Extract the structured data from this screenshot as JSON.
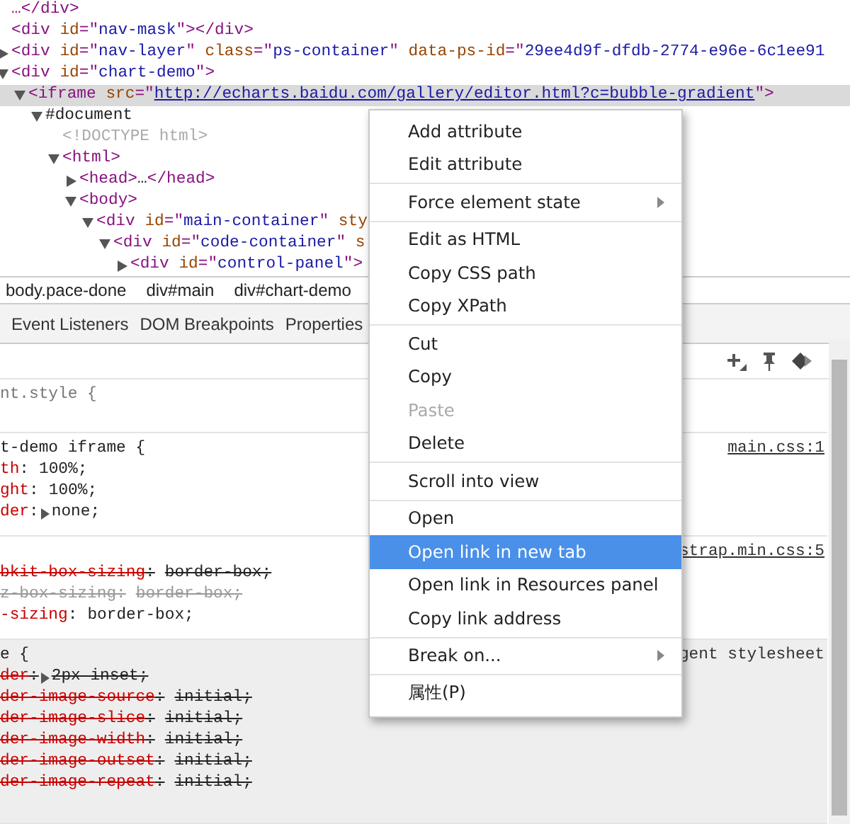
{
  "tree": [
    {
      "selected": false,
      "parts": [
        {
          "kind": "tag",
          "text": "…</div>"
        }
      ]
    },
    {
      "selected": false,
      "parts": [
        {
          "kind": "tag",
          "text": "<div "
        },
        {
          "kind": "attr",
          "text": "id"
        },
        {
          "kind": "tag",
          "text": "=\""
        },
        {
          "kind": "value",
          "text": "nav-mask"
        },
        {
          "kind": "tag",
          "text": "\"></div>"
        }
      ]
    },
    {
      "selected": false,
      "expanded": false,
      "parts": [
        {
          "kind": "tag",
          "text": "<div "
        },
        {
          "kind": "attr",
          "text": "id"
        },
        {
          "kind": "tag",
          "text": "=\""
        },
        {
          "kind": "value",
          "text": "nav-layer"
        },
        {
          "kind": "tag",
          "text": "\" "
        },
        {
          "kind": "attr",
          "text": "class"
        },
        {
          "kind": "tag",
          "text": "=\""
        },
        {
          "kind": "value",
          "text": "ps-container"
        },
        {
          "kind": "tag",
          "text": "\" "
        },
        {
          "kind": "attr",
          "text": "data-ps-id"
        },
        {
          "kind": "tag",
          "text": "=\""
        },
        {
          "kind": "value",
          "text": "29ee4d9f-dfdb-2774-e96e-6c1ee91"
        }
      ]
    },
    {
      "selected": false,
      "expanded": true,
      "parts": [
        {
          "kind": "tag",
          "text": "<div "
        },
        {
          "kind": "attr",
          "text": "id"
        },
        {
          "kind": "tag",
          "text": "=\""
        },
        {
          "kind": "value",
          "text": "chart-demo"
        },
        {
          "kind": "tag",
          "text": "\">"
        }
      ],
      "children": [
        {
          "selected": true,
          "expanded": true,
          "parts": [
            {
              "kind": "tag",
              "text": "<iframe "
            },
            {
              "kind": "attr",
              "text": "src"
            },
            {
              "kind": "tag",
              "text": "=\""
            },
            {
              "kind": "link",
              "text": "http://echarts.baidu.com/gallery/editor.html?c=bubble-gradient"
            },
            {
              "kind": "tag",
              "text": "\">"
            }
          ],
          "children": [
            {
              "selected": false,
              "expanded": true,
              "parts": [
                {
                  "kind": "plain",
                  "text": "#document"
                }
              ],
              "children": [
                {
                  "selected": false,
                  "parts": [
                    {
                      "kind": "comment",
                      "text": "<!DOCTYPE html>"
                    }
                  ]
                },
                {
                  "selected": false,
                  "expanded": true,
                  "parts": [
                    {
                      "kind": "tag",
                      "text": "<html>"
                    }
                  ],
                  "children": [
                    {
                      "selected": false,
                      "expanded": false,
                      "parts": [
                        {
                          "kind": "tag",
                          "text": "<head>"
                        },
                        {
                          "kind": "plain",
                          "text": "…"
                        },
                        {
                          "kind": "tag",
                          "text": "</head>"
                        }
                      ]
                    },
                    {
                      "selected": false,
                      "expanded": true,
                      "parts": [
                        {
                          "kind": "tag",
                          "text": "<body>"
                        }
                      ],
                      "children": [
                        {
                          "selected": false,
                          "expanded": true,
                          "parts": [
                            {
                              "kind": "tag",
                              "text": "<div "
                            },
                            {
                              "kind": "attr",
                              "text": "id"
                            },
                            {
                              "kind": "tag",
                              "text": "=\""
                            },
                            {
                              "kind": "value",
                              "text": "main-container"
                            },
                            {
                              "kind": "tag",
                              "text": "\" "
                            },
                            {
                              "kind": "attr",
                              "text": "sty"
                            }
                          ],
                          "children": [
                            {
                              "selected": false,
                              "expanded": true,
                              "parts": [
                                {
                                  "kind": "tag",
                                  "text": "<div "
                                },
                                {
                                  "kind": "attr",
                                  "text": "id"
                                },
                                {
                                  "kind": "tag",
                                  "text": "=\""
                                },
                                {
                                  "kind": "value",
                                  "text": "code-container"
                                },
                                {
                                  "kind": "tag",
                                  "text": "\" "
                                },
                                {
                                  "kind": "attr",
                                  "text": "s"
                                }
                              ],
                              "children": [
                                {
                                  "selected": false,
                                  "expanded": false,
                                  "parts": [
                                    {
                                      "kind": "tag",
                                      "text": "<div "
                                    },
                                    {
                                      "kind": "attr",
                                      "text": "id"
                                    },
                                    {
                                      "kind": "tag",
                                      "text": "=\""
                                    },
                                    {
                                      "kind": "value",
                                      "text": "control-panel"
                                    },
                                    {
                                      "kind": "tag",
                                      "text": "\">"
                                    }
                                  ]
                                }
                              ]
                            }
                          ]
                        }
                      ]
                    }
                  ]
                }
              ]
            }
          ]
        }
      ]
    }
  ],
  "breadcrumbs": [
    "body.pace-done",
    "div#main",
    "div#chart-demo"
  ],
  "tabs": [
    "Event Listeners",
    "DOM Breakpoints",
    "Properties"
  ],
  "styles": [
    {
      "selector": "nt.style {",
      "user_agent": false
    },
    {
      "selector": "t-demo iframe {",
      "source": "main.css:1",
      "user_agent": false,
      "props": [
        {
          "name": "th",
          "colon": ":",
          "value": "100%;",
          "struck": false,
          "inactive": false,
          "expandable": false
        },
        {
          "name": "ght",
          "colon": ":",
          "value": "100%;",
          "struck": false,
          "inactive": false,
          "expandable": false
        },
        {
          "name": "der",
          "colon": ":",
          "value": "none;",
          "struck": false,
          "inactive": false,
          "expandable": true
        }
      ]
    },
    {
      "source": "strap.min.css:5",
      "user_agent": false,
      "props": [
        {
          "name": "bkit-box-sizing",
          "colon": ":",
          "value": "border-box;",
          "struck": true,
          "inactive": false,
          "expandable": false
        },
        {
          "name": "z-box-sizing",
          "colon": ":",
          "value": "border-box;",
          "struck": true,
          "inactive": true,
          "expandable": false
        },
        {
          "name": "-sizing",
          "colon": ":",
          "value": "border-box;",
          "struck": false,
          "inactive": false,
          "expandable": false
        }
      ]
    },
    {
      "selector": "e {",
      "source": "gent stylesheet",
      "user_agent": true,
      "props": [
        {
          "name": "der",
          "colon": ":",
          "value": "2px inset;",
          "struck": true,
          "inactive": false,
          "expandable": true
        },
        {
          "name": "der-image-source",
          "colon": ":",
          "value": "initial;",
          "struck": true,
          "inactive": false,
          "expandable": false
        },
        {
          "name": "der-image-slice",
          "colon": ":",
          "value": "initial;",
          "struck": true,
          "inactive": false,
          "expandable": false
        },
        {
          "name": "der-image-width",
          "colon": ":",
          "value": "initial;",
          "struck": true,
          "inactive": false,
          "expandable": false
        },
        {
          "name": "der-image-outset",
          "colon": ":",
          "value": "initial;",
          "struck": true,
          "inactive": false,
          "expandable": false
        },
        {
          "name": "der-image-repeat",
          "colon": ":",
          "value": "initial;",
          "struck": true,
          "inactive": false,
          "expandable": false
        }
      ]
    }
  ],
  "context_menu": [
    [
      {
        "label": "Add attribute",
        "selected": false,
        "disabled": false,
        "submenu": false
      },
      {
        "label": "Edit attribute",
        "selected": false,
        "disabled": false,
        "submenu": false
      }
    ],
    [
      {
        "label": "Force element state",
        "selected": false,
        "disabled": false,
        "submenu": true
      }
    ],
    [
      {
        "label": "Edit as HTML",
        "selected": false,
        "disabled": false,
        "submenu": false
      },
      {
        "label": "Copy CSS path",
        "selected": false,
        "disabled": false,
        "submenu": false
      },
      {
        "label": "Copy XPath",
        "selected": false,
        "disabled": false,
        "submenu": false
      }
    ],
    [
      {
        "label": "Cut",
        "selected": false,
        "disabled": false,
        "submenu": false
      },
      {
        "label": "Copy",
        "selected": false,
        "disabled": false,
        "submenu": false
      },
      {
        "label": "Paste",
        "selected": false,
        "disabled": true,
        "submenu": false
      },
      {
        "label": "Delete",
        "selected": false,
        "disabled": false,
        "submenu": false
      }
    ],
    [
      {
        "label": "Scroll into view",
        "selected": false,
        "disabled": false,
        "submenu": false
      }
    ],
    [
      {
        "label": "Open",
        "selected": false,
        "disabled": false,
        "submenu": false
      },
      {
        "label": "Open link in new tab",
        "selected": true,
        "disabled": false,
        "submenu": false
      },
      {
        "label": "Open link in Resources panel",
        "selected": false,
        "disabled": false,
        "submenu": false
      },
      {
        "label": "Copy link address",
        "selected": false,
        "disabled": false,
        "submenu": false
      }
    ],
    [
      {
        "label": "Break on...",
        "selected": false,
        "disabled": false,
        "submenu": true
      }
    ],
    [
      {
        "label": "属性(P)",
        "selected": false,
        "disabled": false,
        "submenu": false
      }
    ]
  ]
}
